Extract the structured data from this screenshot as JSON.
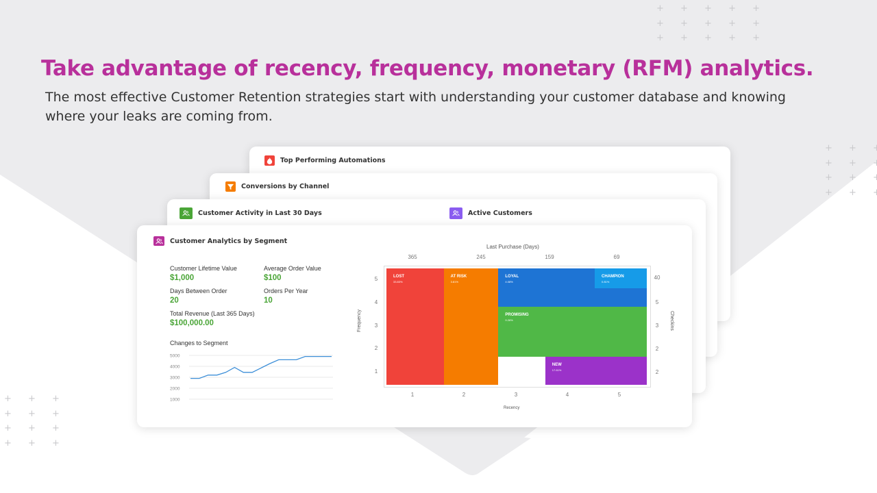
{
  "headline": "Take advantage of recency, frequency, monetary (RFM) analytics.",
  "subtext": "The most effective Customer Retention strategies start with understanding your customer database and knowing where your leaks are coming from.",
  "colors": {
    "headline": "#b8309b",
    "green": "#4aa537",
    "lost": "#f0433a",
    "at_risk": "#f57c00",
    "loyal": "#1e74d4",
    "champion": "#169be8",
    "promising": "#50b847",
    "new": "#9b32c9"
  },
  "cards": {
    "top_automations": {
      "title": "Top Performing Automations",
      "icon": "fire-icon"
    },
    "conversions": {
      "title": "Conversions by Channel",
      "icon": "filter-icon"
    },
    "activity": {
      "title": "Customer Activity in Last 30 Days",
      "icon": "users-icon"
    },
    "active_customers": {
      "title": "Active Customers",
      "icon": "users-icon"
    }
  },
  "segment_card": {
    "title": "Customer Analytics by Segment",
    "metrics": {
      "ltv_label": "Customer Lifetime Value",
      "ltv_value": "$1,000",
      "aov_label": "Average Order Value",
      "aov_value": "$100",
      "days_label": "Days Between Order",
      "days_value": "20",
      "orders_label": "Orders Per Year",
      "orders_value": "10",
      "revenue_label": "Total Revenue (Last 365 Days)",
      "revenue_value": "$100,000.00"
    },
    "changes_title": "Changes to Segment"
  },
  "chart_data": [
    {
      "type": "line",
      "title": "Changes to Segment",
      "yticks": [
        "5000",
        "4000",
        "3000",
        "2000",
        "1000"
      ],
      "ylim": [
        1000,
        5000
      ],
      "x": [
        0,
        1,
        2,
        3,
        4,
        5,
        6,
        7,
        8,
        9,
        10,
        11,
        12,
        13,
        14,
        15,
        16
      ],
      "values": [
        2900,
        2900,
        3200,
        3200,
        3450,
        3900,
        3450,
        3450,
        3850,
        4250,
        4600,
        4600,
        4600,
        4900,
        4900,
        4900,
        4900
      ],
      "grid": true
    },
    {
      "type": "heatmap",
      "top_label": "Last Purchase (Days)",
      "top_ticks": [
        "365",
        "245",
        "159",
        "69"
      ],
      "xlabel": "Recency",
      "xticks": [
        "1",
        "2",
        "3",
        "4",
        "5"
      ],
      "ylabel": "Frequency",
      "yticks": [
        "5",
        "4",
        "3",
        "2",
        "1"
      ],
      "right_label": "Checkins",
      "right_ticks": [
        "40",
        "5",
        "3",
        "2",
        "2"
      ],
      "segments": [
        {
          "name": "LOST",
          "pct": "33.83%"
        },
        {
          "name": "AT RISK",
          "pct": "3.81%"
        },
        {
          "name": "LOYAL",
          "pct": "4.08%"
        },
        {
          "name": "CHAMPION",
          "pct": "0.81%"
        },
        {
          "name": "PROMISING",
          "pct": "9.26%"
        },
        {
          "name": "NEW",
          "pct": "17.61%"
        }
      ]
    }
  ]
}
